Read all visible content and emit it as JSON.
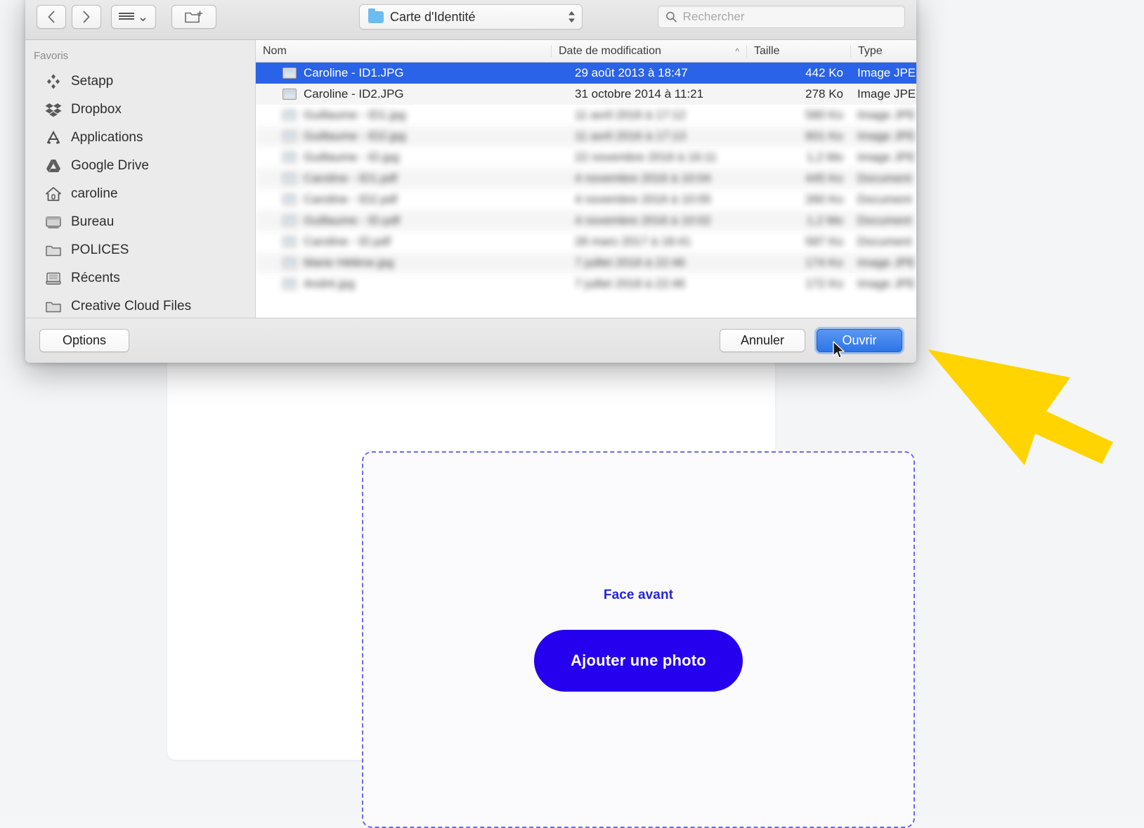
{
  "page": {
    "dropzone_label": "Face avant",
    "add_photo_button": "Ajouter une photo"
  },
  "dialog": {
    "toolbar": {
      "back_icon": "chevron-left-icon",
      "forward_icon": "chevron-right-icon",
      "view_icon": "list-view-icon",
      "new_folder_icon": "new-folder-icon",
      "path_title": "Carte d'Identité",
      "path_icon": "folder-icon",
      "stepper_icon": "up-down-stepper-icon",
      "search_placeholder": "Rechercher",
      "search_value": "",
      "search_icon": "search-icon"
    },
    "sidebar": {
      "header": "Favoris",
      "items": [
        {
          "label": "Setapp",
          "icon": "setapp-icon"
        },
        {
          "label": "Dropbox",
          "icon": "dropbox-icon"
        },
        {
          "label": "Applications",
          "icon": "applications-icon"
        },
        {
          "label": "Google Drive",
          "icon": "google-drive-icon"
        },
        {
          "label": "caroline",
          "icon": "home-icon"
        },
        {
          "label": "Bureau",
          "icon": "desktop-icon"
        },
        {
          "label": "POLICES",
          "icon": "folder-icon"
        },
        {
          "label": "Récents",
          "icon": "recents-icon"
        },
        {
          "label": "Creative Cloud Files",
          "icon": "folder-icon"
        }
      ]
    },
    "filelist": {
      "columns": {
        "name": "Nom",
        "date": "Date de modification",
        "size": "Taille",
        "type": "Type"
      },
      "sort_indicator": "▲",
      "rows": [
        {
          "name": "Caroline - ID1.JPG",
          "date": "29 août 2013 à 18:47",
          "size": "442 Ko",
          "type": "Image JPE",
          "selected": true,
          "blurred": false
        },
        {
          "name": "Caroline - ID2.JPG",
          "date": "31 octobre 2014 à 11:21",
          "size": "278 Ko",
          "type": "Image JPE",
          "selected": false,
          "blurred": false
        },
        {
          "name": "Guillaume - ID1.jpg",
          "date": "11 avril 2016 à 17:12",
          "size": "580 Ko",
          "type": "Image JPE",
          "selected": false,
          "blurred": true
        },
        {
          "name": "Guillaume - ID2.jpg",
          "date": "11 avril 2016 à 17:13",
          "size": "601 Ko",
          "type": "Image JPE",
          "selected": false,
          "blurred": true
        },
        {
          "name": "Guillaume - ID.jpg",
          "date": "22 novembre 2016 à 16:11",
          "size": "1,2 Mo",
          "type": "Image JPE",
          "selected": false,
          "blurred": true
        },
        {
          "name": "Caroline - ID1.pdf",
          "date": "4 novembre 2016 à 10:04",
          "size": "445 Ko",
          "type": "Document",
          "selected": false,
          "blurred": true
        },
        {
          "name": "Caroline - ID2.pdf",
          "date": "4 novembre 2016 à 10:05",
          "size": "260 Ko",
          "type": "Document",
          "selected": false,
          "blurred": true
        },
        {
          "name": "Guillaume - ID.pdf",
          "date": "4 novembre 2016 à 10:02",
          "size": "1,2 Mo",
          "type": "Document",
          "selected": false,
          "blurred": true
        },
        {
          "name": "Caroline - ID.pdf",
          "date": "28 mars 2017 à 18:41",
          "size": "587 Ko",
          "type": "Document",
          "selected": false,
          "blurred": true
        },
        {
          "name": "Marie Hélène.jpg",
          "date": "7 juillet 2018 à 22:46",
          "size": "174 Ko",
          "type": "Image JPE",
          "selected": false,
          "blurred": true
        },
        {
          "name": "André.jpg",
          "date": "7 juillet 2018 à 22:46",
          "size": "172 Ko",
          "type": "Image JPE",
          "selected": false,
          "blurred": true
        }
      ]
    },
    "footer": {
      "options": "Options",
      "cancel": "Annuler",
      "open": "Ouvrir"
    }
  },
  "annotation": {
    "cursor_icon": "mouse-pointer-icon",
    "highlight_arrow_icon": "yellow-arrow-icon",
    "highlight_color": "#FFD400"
  }
}
